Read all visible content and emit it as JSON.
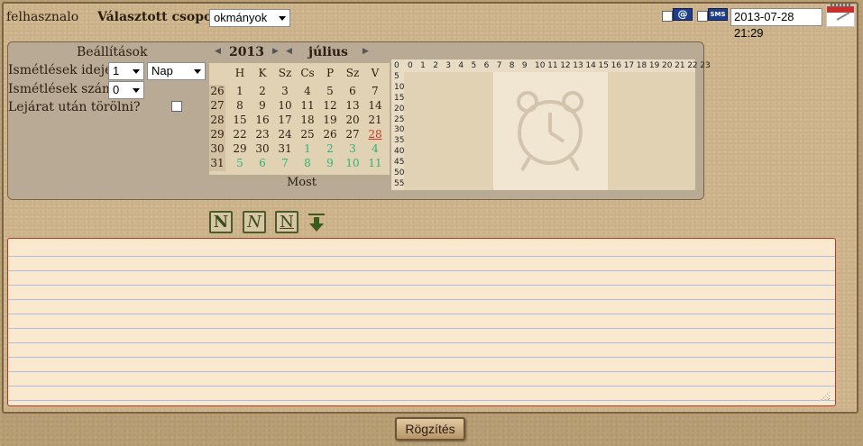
{
  "header": {
    "username": "felhasznalo",
    "group_label": "Választott csoport",
    "group_selected": "okmányok",
    "mail_icon": "envelope-at-icon",
    "sms_icon": "sms-icon",
    "sms_icon_text": "SMS",
    "datetime": "2013-07-28 21:29",
    "calendar_icon": "calendar-pen-icon"
  },
  "settings": {
    "title": "Beállítások",
    "repeat_time_label": "Ismétlések ideje",
    "repeat_time_value": "1",
    "repeat_unit_value": "Nap",
    "repeat_count_label": "Ismétlések száma",
    "repeat_count_value": "0",
    "delete_after_label": "Lejárat után törölni?"
  },
  "calendar": {
    "year": "2013",
    "month": "július",
    "weekday_headers": [
      "H",
      "K",
      "Sz",
      "Cs",
      "P",
      "Sz",
      "V"
    ],
    "week_numbers": [
      "26",
      "27",
      "28",
      "29",
      "30",
      "31"
    ],
    "weeks": [
      [
        "1",
        "2",
        "3",
        "4",
        "5",
        "6",
        "7"
      ],
      [
        "8",
        "9",
        "10",
        "11",
        "12",
        "13",
        "14"
      ],
      [
        "15",
        "16",
        "17",
        "18",
        "19",
        "20",
        "21"
      ],
      [
        "22",
        "23",
        "24",
        "25",
        "26",
        "27",
        "28"
      ],
      [
        "29",
        "30",
        "31",
        "1",
        "2",
        "3",
        "4"
      ],
      [
        "5",
        "6",
        "7",
        "8",
        "9",
        "10",
        "11"
      ]
    ],
    "today": "28",
    "now_label": "Most",
    "colors": {
      "other_month": "#2fb37a",
      "today": "#c0392b"
    }
  },
  "time_picker": {
    "hours": [
      "0",
      "1",
      "2",
      "3",
      "4",
      "5",
      "6",
      "7",
      "8",
      "9",
      "10",
      "11",
      "12",
      "13",
      "14",
      "15",
      "16",
      "17",
      "18",
      "19",
      "20",
      "21",
      "22",
      "23"
    ],
    "minutes": [
      "0",
      "5",
      "10",
      "15",
      "20",
      "25",
      "30",
      "35",
      "40",
      "45",
      "50",
      "55"
    ],
    "watermark_icon": "alarm-clock-icon"
  },
  "toolbar": {
    "bold_label": "N",
    "italic_label": "N",
    "underline_label": "N",
    "down_icon": "arrow-down-icon"
  },
  "note": {
    "value": ""
  },
  "save_label": "Rögzítés"
}
